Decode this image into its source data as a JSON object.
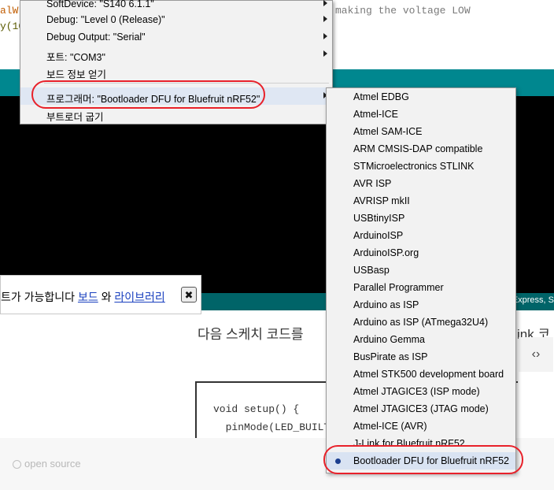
{
  "editor": {
    "lines": [
      "alW",
      "y(10"
    ],
    "comment": "making the voltage LOW"
  },
  "tools_menu": {
    "items": [
      {
        "label": "SoftDevice: \"S140 6.1.1\"",
        "submenu": true
      },
      {
        "label": "Debug: \"Level 0 (Release)\"",
        "submenu": true
      },
      {
        "label": "Debug Output: \"Serial\"",
        "submenu": true
      },
      {
        "label": "포트: \"COM3\"",
        "submenu": true
      },
      {
        "label": "보드 정보 얻기",
        "submenu": false
      },
      {
        "label": "프로그래머: \"Bootloader DFU for Bluefruit nRF52\"",
        "submenu": true
      },
      {
        "label": "부트로더 굽기",
        "submenu": false
      }
    ]
  },
  "programmer_menu": {
    "items": [
      "Atmel EDBG",
      "Atmel-ICE",
      "Atmel SAM-ICE",
      "ARM CMSIS-DAP compatible",
      "STMicroelectronics STLINK",
      "AVR ISP",
      "AVRISP mkII",
      "USBtinyISP",
      "ArduinoISP",
      "ArduinoISP.org",
      "USBasp",
      "Parallel Programmer",
      "Arduino as ISP",
      "Arduino as ISP (ATmega32U4)",
      "Arduino Gemma",
      "BusPirate as ISP",
      "Atmel STK500 development board",
      "Atmel JTAGICE3 (ISP mode)",
      "Atmel JTAGICE3 (JTAG mode)",
      "Atmel-ICE (AVR)",
      "J-Link for Bluefruit nRF52",
      "Bootloader DFU for Bluefruit nRF52"
    ],
    "selected_index": 21
  },
  "notification": {
    "text": "트가 가능합니다",
    "link_boards": "보드",
    "joiner": "와",
    "link_libraries": "라이브러리",
    "close": "✖"
  },
  "status_bar": {
    "text": ") Express, S"
  },
  "webpage": {
    "sentence_start": "다음 스케치 코드를",
    "sentence_end": "ink 코",
    "code_toggle": "‹›",
    "code_lines": [
      "void setup() {",
      "  pinMode(LED_BUILT"
    ],
    "footer_text": "open source"
  },
  "colors": {
    "teal": "#00878f",
    "status_teal": "#006468",
    "annotation_red": "#e8212a",
    "link_blue": "#1a40bf"
  }
}
